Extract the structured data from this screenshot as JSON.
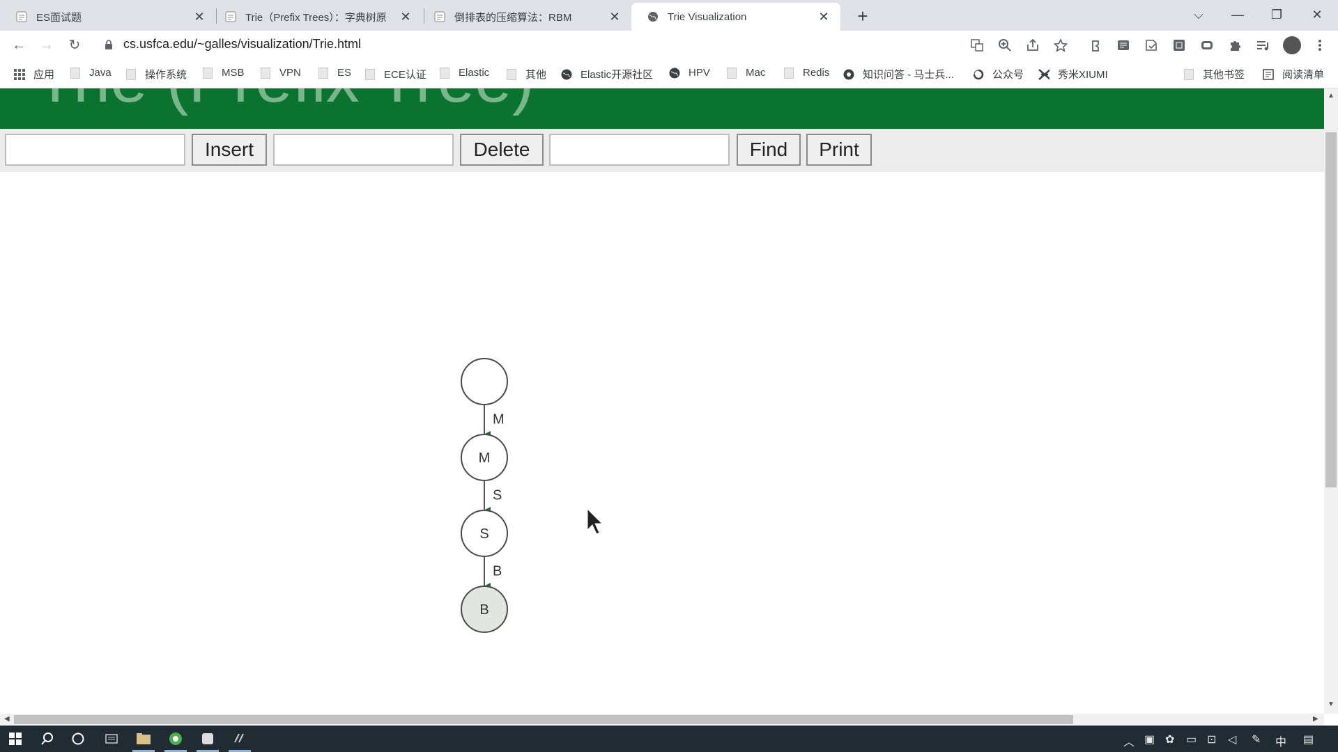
{
  "browser": {
    "tabs": [
      {
        "title": "ES面试题",
        "active": false
      },
      {
        "title": "Trie（Prefix Trees）：字典树原",
        "active": false
      },
      {
        "title": "倒排表的压缩算法：RBM",
        "active": false
      },
      {
        "title": "Trie Visualization",
        "active": true
      }
    ],
    "url": "cs.usfca.edu/~galles/visualization/Trie.html"
  },
  "bookmarks": [
    {
      "label": "应用",
      "icon": "apps-grid-icon"
    },
    {
      "label": "Java",
      "icon": "folder-icon"
    },
    {
      "label": "操作系统",
      "icon": "folder-icon"
    },
    {
      "label": "MSB",
      "icon": "folder-icon"
    },
    {
      "label": "VPN",
      "icon": "folder-icon"
    },
    {
      "label": "ES",
      "icon": "folder-icon"
    },
    {
      "label": "ECE认证",
      "icon": "folder-icon"
    },
    {
      "label": "Elastic",
      "icon": "folder-icon"
    },
    {
      "label": "其他",
      "icon": "folder-icon"
    },
    {
      "label": "Elastic开源社区",
      "icon": "globe-icon"
    },
    {
      "label": "HPV",
      "icon": "globe-icon"
    },
    {
      "label": "Mac",
      "icon": "folder-icon"
    },
    {
      "label": "Redis",
      "icon": "folder-icon"
    },
    {
      "label": "知识问答 - 马士兵...",
      "icon": "site-icon"
    },
    {
      "label": "公众号",
      "icon": "swirl-icon"
    },
    {
      "label": "秀米XIUMI",
      "icon": "xiumi-icon"
    },
    {
      "label": "其他书签",
      "icon": "folder-icon"
    },
    {
      "label": "阅读清单",
      "icon": "reading-list-icon"
    }
  ],
  "page": {
    "banner_title": "Trie (Prefix Tree)",
    "controls": {
      "insert_value": "",
      "insert_label": "Insert",
      "delete_value": "",
      "delete_label": "Delete",
      "find_value": "",
      "find_label": "Find",
      "print_label": "Print"
    },
    "trie": {
      "nodes": [
        {
          "id": "root",
          "label": "",
          "highlighted": false
        },
        {
          "id": "M",
          "label": "M",
          "highlighted": false
        },
        {
          "id": "S",
          "label": "S",
          "highlighted": false
        },
        {
          "id": "B",
          "label": "B",
          "highlighted": true
        }
      ],
      "edges": [
        {
          "from": "root",
          "to": "M",
          "label": "M"
        },
        {
          "from": "M",
          "to": "S",
          "label": "S"
        },
        {
          "from": "S",
          "to": "B",
          "label": "B"
        }
      ]
    }
  },
  "taskbar": {
    "ime": "中"
  }
}
